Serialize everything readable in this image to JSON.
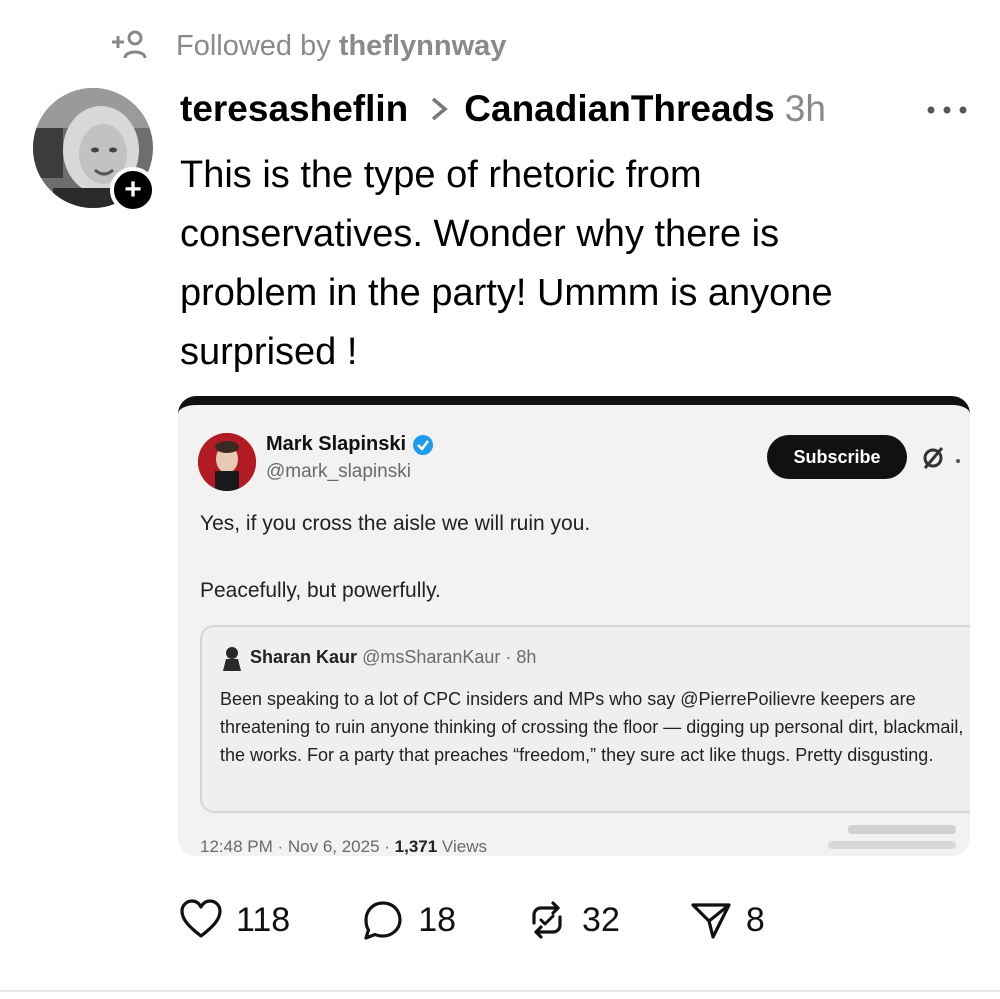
{
  "followed": {
    "prefix": "Followed by",
    "user": "theflynnway"
  },
  "post": {
    "username": "teresasheflin",
    "community": "CanadianThreads",
    "time": "3h",
    "text": "This is the type of rhetoric from\nconservatives.  Wonder why there is\nproblem in the party!  Ummm  is anyone\nsurprised !",
    "plus_badge": "+"
  },
  "embed": {
    "author_name": "Mark Slapinski",
    "author_handle": "@mark_slapinski",
    "subscribe_label": "Subscribe",
    "text_line1": "Yes, if you cross the aisle we will ruin you.",
    "text_line2": "Peacefully, but powerfully.",
    "quote": {
      "author_name": "Sharan Kaur",
      "author_meta": "@msSharanKaur · 8h",
      "text": "Been speaking to a lot of CPC insiders and MPs who say @PierrePoilievre keepers are threatening to ruin anyone thinking of crossing the floor — digging up personal dirt, blackmail, the works. For a party that preaches “freedom,” they sure act like thugs. Pretty disgusting."
    },
    "timestamp": "12:48 PM · Nov 6, 2025 · ",
    "views_count": "1,371",
    "views_label": " Views"
  },
  "actions": {
    "likes": "118",
    "replies": "18",
    "reposts": "32",
    "shares": "8"
  },
  "icons": [
    "follow-icon",
    "chevron-right-icon",
    "more-icon",
    "verified-icon",
    "heart-icon",
    "reply-icon",
    "repost-icon",
    "share-icon"
  ]
}
